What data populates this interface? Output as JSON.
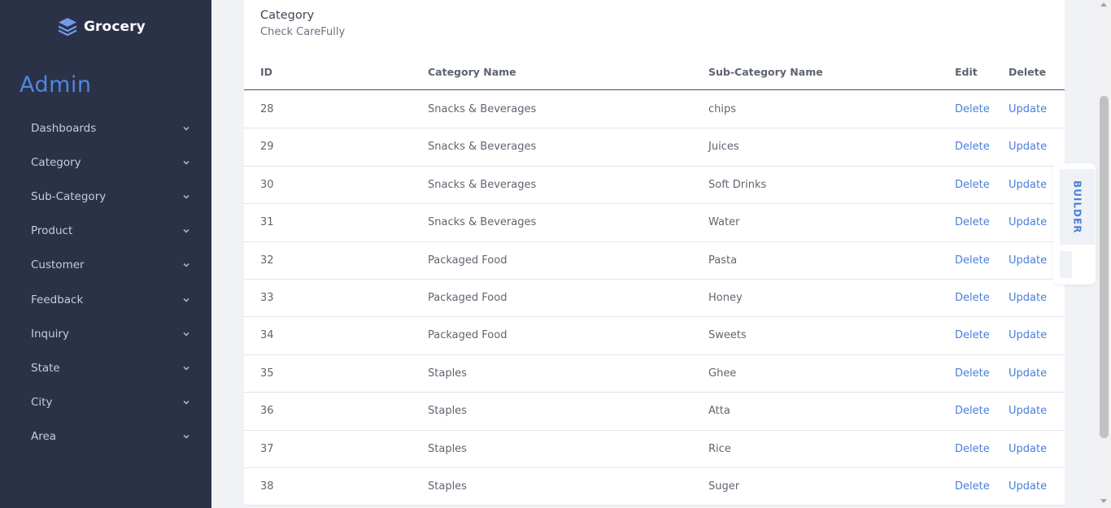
{
  "sidebar": {
    "brand": "Grocery",
    "brand_icon": "layers-icon",
    "admin_title": "Admin",
    "items": [
      {
        "label": "Dashboards"
      },
      {
        "label": "Category"
      },
      {
        "label": "Sub-Category"
      },
      {
        "label": "Product"
      },
      {
        "label": "Customer"
      },
      {
        "label": "Feedback"
      },
      {
        "label": "Inquiry"
      },
      {
        "label": "State"
      },
      {
        "label": "City"
      },
      {
        "label": "Area"
      }
    ]
  },
  "card": {
    "title": "Category",
    "subtitle": "Check CareFully"
  },
  "table": {
    "headers": {
      "id": "ID",
      "category": "Category Name",
      "sub": "Sub-Category Name",
      "edit": "Edit",
      "delete": "Delete"
    },
    "rows": [
      {
        "id": "28",
        "category": "Snacks & Beverages",
        "sub": "chips",
        "edit_link": "Delete",
        "delete_link": "Update"
      },
      {
        "id": "29",
        "category": "Snacks & Beverages",
        "sub": "Juices",
        "edit_link": "Delete",
        "delete_link": "Update"
      },
      {
        "id": "30",
        "category": "Snacks & Beverages",
        "sub": "Soft Drinks",
        "edit_link": "Delete",
        "delete_link": "Update"
      },
      {
        "id": "31",
        "category": "Snacks & Beverages",
        "sub": "Water",
        "edit_link": "Delete",
        "delete_link": "Update"
      },
      {
        "id": "32",
        "category": "Packaged Food",
        "sub": "Pasta",
        "edit_link": "Delete",
        "delete_link": "Update"
      },
      {
        "id": "33",
        "category": "Packaged Food",
        "sub": "Honey",
        "edit_link": "Delete",
        "delete_link": "Update"
      },
      {
        "id": "34",
        "category": "Packaged Food",
        "sub": "Sweets",
        "edit_link": "Delete",
        "delete_link": "Update"
      },
      {
        "id": "35",
        "category": "Staples",
        "sub": "Ghee",
        "edit_link": "Delete",
        "delete_link": "Update"
      },
      {
        "id": "36",
        "category": "Staples",
        "sub": "Atta",
        "edit_link": "Delete",
        "delete_link": "Update"
      },
      {
        "id": "37",
        "category": "Staples",
        "sub": "Rice",
        "edit_link": "Delete",
        "delete_link": "Update"
      },
      {
        "id": "38",
        "category": "Staples",
        "sub": "Suger",
        "edit_link": "Delete",
        "delete_link": "Update"
      }
    ]
  },
  "builder": {
    "label": "BUILDER"
  },
  "colors": {
    "sidebar_bg": "#2b3147",
    "accent": "#4e86e4",
    "link": "#4a7fd8"
  }
}
